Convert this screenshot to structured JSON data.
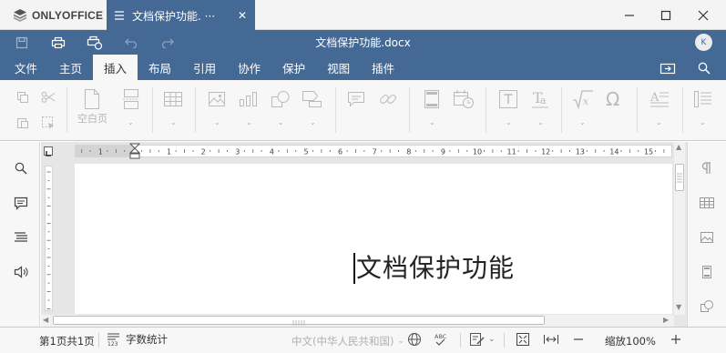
{
  "app": {
    "name": "ONLYOFFICE",
    "tab_title": "文档保护功能. ···"
  },
  "header": {
    "doc_title": "文档保护功能.docx",
    "avatar_initial": "K",
    "tabs": [
      "文件",
      "主页",
      "插入",
      "布局",
      "引用",
      "协作",
      "保护",
      "视图",
      "插件"
    ],
    "active_tab": "插入"
  },
  "toolbar": {
    "blank_page_label": "空白页"
  },
  "document": {
    "text": "文档保护功能"
  },
  "ruler": {
    "numbers": [
      "1",
      "1",
      "2",
      "3",
      "4",
      "5",
      "6",
      "7",
      "8",
      "9",
      "10",
      "11",
      "12",
      "13",
      "14",
      "15"
    ]
  },
  "statusbar": {
    "page_info": "第1页共1页",
    "word_count": "字数统计",
    "language": "中文(中华人民共和国)",
    "zoom": "缩放100%"
  },
  "colors": {
    "brand": "#446995",
    "panel": "#f7f7f7"
  }
}
